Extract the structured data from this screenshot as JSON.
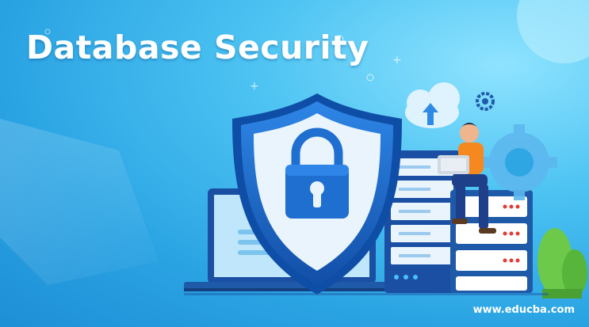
{
  "title": "Database Security",
  "watermark": "www.educba.com",
  "icons": [
    "shield-icon",
    "padlock-icon",
    "cloud-upload-icon",
    "gear-icon",
    "laptop-icon",
    "server-rack-icon",
    "person-icon",
    "plant-icon"
  ],
  "colors": {
    "background": "#2aa3e3",
    "shield_outer": "#1565c8",
    "shield_inner": "#2f8ae6",
    "shield_face": "#e9f4fd",
    "lock": "#1f6fd0",
    "server": "#1e5aa8",
    "shirt": "#f5891f",
    "plant": "#6cc94a"
  }
}
